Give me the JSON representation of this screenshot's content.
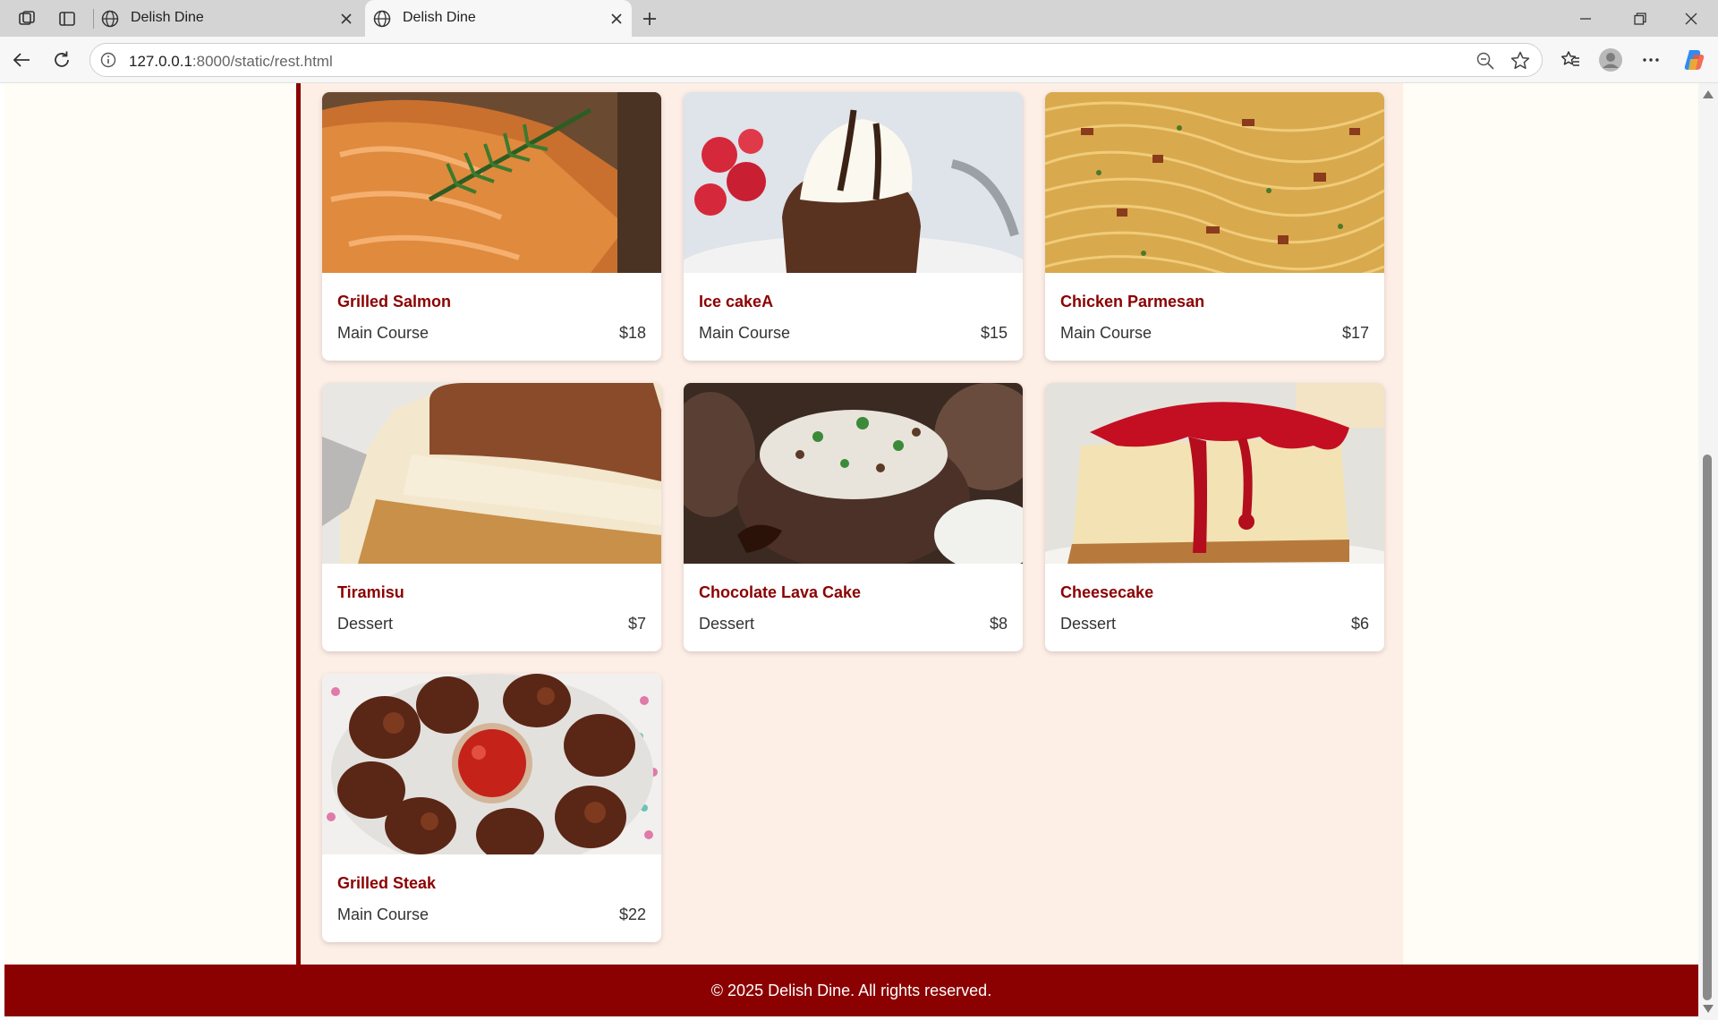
{
  "browser": {
    "tabs": [
      {
        "title": "Delish Dine",
        "active": false
      },
      {
        "title": "Delish Dine",
        "active": true
      }
    ],
    "url_host": "127.0.0.1",
    "url_path": ":8000/static/rest.html"
  },
  "menu": {
    "items": [
      {
        "name": "Grilled Salmon",
        "category": "Main Course",
        "price": "$18",
        "image": "grilled-salmon-photo"
      },
      {
        "name": "Ice cakeA",
        "category": "Main Course",
        "price": "$15",
        "image": "lava-cake-icecream-photo"
      },
      {
        "name": "Chicken Parmesan",
        "category": "Main Course",
        "price": "$17",
        "image": "spaghetti-carbonara-photo"
      },
      {
        "name": "Tiramisu",
        "category": "Dessert",
        "price": "$7",
        "image": "tiramisu-photo"
      },
      {
        "name": "Chocolate Lava Cake",
        "category": "Dessert",
        "price": "$8",
        "image": "stuffed-mushroom-photo"
      },
      {
        "name": "Cheesecake",
        "category": "Dessert",
        "price": "$6",
        "image": "cheesecake-photo"
      },
      {
        "name": "Grilled Steak",
        "category": "Main Course",
        "price": "$22",
        "image": "fried-chicken-photo"
      }
    ]
  },
  "footer": {
    "text": "© 2025 Delish Dine. All rights reserved."
  },
  "colors": {
    "accent": "#8b0000",
    "panel": "#fdeee6",
    "page_bg": "#fffdf5"
  }
}
